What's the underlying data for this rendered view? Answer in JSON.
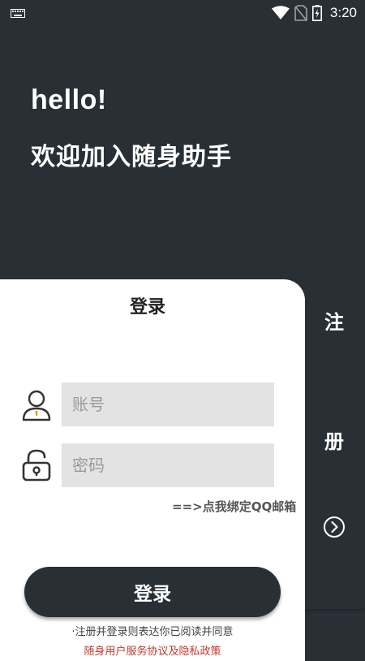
{
  "status_bar": {
    "time": "3:20",
    "icons": [
      "keyboard-icon",
      "wifi-icon",
      "no-sim-icon",
      "battery-charging-icon"
    ]
  },
  "header": {
    "greeting": "hello!",
    "welcome": "欢迎加入随身助手"
  },
  "login": {
    "title": "登录",
    "account_placeholder": "账号",
    "password_placeholder": "密码",
    "bind_qq_link": "==>点我绑定QQ邮箱",
    "login_button": "登录",
    "agreement_text": "·注册并登录则表达你已阅读并同意",
    "policy_link": "随身用户服务协议及隐私政策"
  },
  "register_panel": {
    "char_1": "注",
    "char_2": "册"
  },
  "colors": {
    "dark": "#283036",
    "input_bg": "#e3e3e3",
    "policy_red": "#c0392b"
  }
}
